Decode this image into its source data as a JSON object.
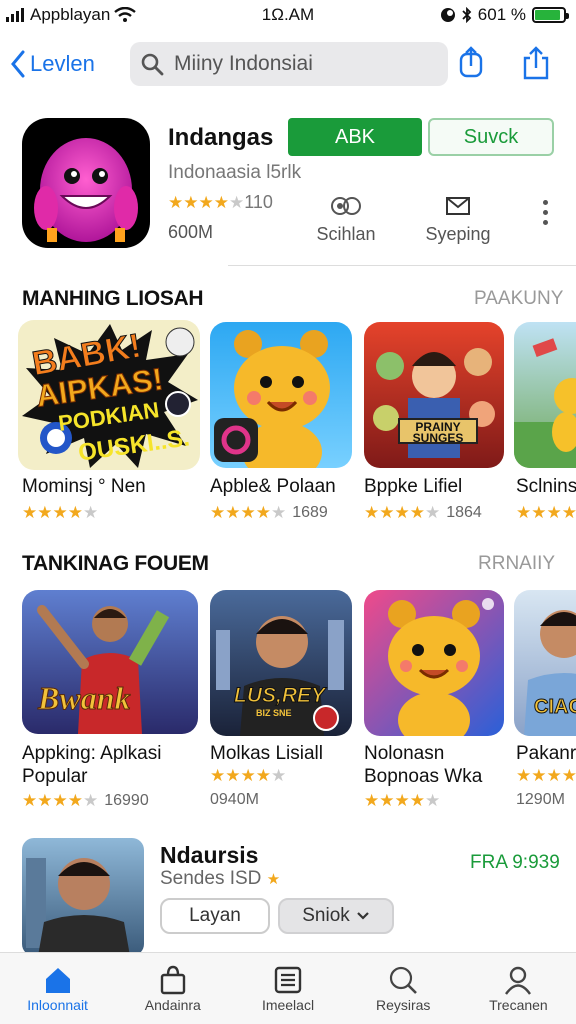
{
  "status_bar": {
    "carrier": "Appblayan",
    "time": "1Ω.AM",
    "battery": "601 %",
    "battery_level": 0.9
  },
  "nav": {
    "back_label": "Levlen",
    "search_text": "Miiny Indonsiai",
    "icons": [
      "share-icon",
      "upload-icon"
    ]
  },
  "app": {
    "title": "Indangas",
    "get_label": "ABK",
    "alt_label": "Suvck",
    "subtitle": "Indonaasia l5rlk",
    "rating_count": "110",
    "rating": 4,
    "size": "600M",
    "meta": [
      {
        "icon": "link-icon",
        "label": "Scihlan"
      },
      {
        "icon": "mail-icon",
        "label": "Syeping"
      }
    ]
  },
  "section1": {
    "title": "MANHING LIOSAH",
    "link": "PAAKUNY",
    "cards": [
      {
        "name": "Mominsj ° Nen",
        "rating": 4,
        "count": "",
        "art_lines": [
          "BABK!",
          "AIPKAS!",
          "PODKIAN",
          "OUSKI..S."
        ]
      },
      {
        "name": "Apble& Polaan",
        "rating": 4,
        "count": "1689",
        "art_lines": []
      },
      {
        "name": "Bppke Lifiel",
        "rating": 4,
        "count": "1864",
        "art_lines": [
          "PRAINY",
          "SUNGES"
        ]
      },
      {
        "name": "Sclnins",
        "rating": 4,
        "count": "",
        "art_lines": []
      }
    ]
  },
  "section2": {
    "title": "TANKINAG FOUEM",
    "link": "RRNAIIY",
    "cards": [
      {
        "name": "Appking: Aplkasi",
        "name2": "Popular",
        "rating": 4,
        "count": "16990",
        "art_lines": [
          "Bwank"
        ]
      },
      {
        "name": "Molkas Lisiall",
        "name2": "",
        "rating": 4,
        "count": "0940M",
        "art_lines": [
          "LUS,REY",
          "BIZ SNE"
        ]
      },
      {
        "name": "Nolonasn",
        "name2": "Bopnoas Wka",
        "rating": 4,
        "count": "",
        "art_lines": []
      },
      {
        "name": "Pakanr",
        "name2": "",
        "rating": 4,
        "count": "1290M",
        "art_lines": [
          "CIAC"
        ]
      }
    ]
  },
  "bottom_app": {
    "title": "Ndaursis",
    "subtitle": "Sendes ISD",
    "price": "FRA 9:939",
    "btn1": "Layan",
    "btn2": "Sniok"
  },
  "tabbar": [
    {
      "icon": "home-icon",
      "label": "Inloonnait",
      "active": true
    },
    {
      "icon": "bag-icon",
      "label": "Andainra",
      "active": false
    },
    {
      "icon": "list-icon",
      "label": "Imeelacl",
      "active": false
    },
    {
      "icon": "search-icon",
      "label": "Reysiras",
      "active": false
    },
    {
      "icon": "person-icon",
      "label": "Trecanen",
      "active": false
    }
  ],
  "colors": {
    "accent": "#1a73e8",
    "green": "#1a9b3a",
    "star": "#f2a81d"
  }
}
